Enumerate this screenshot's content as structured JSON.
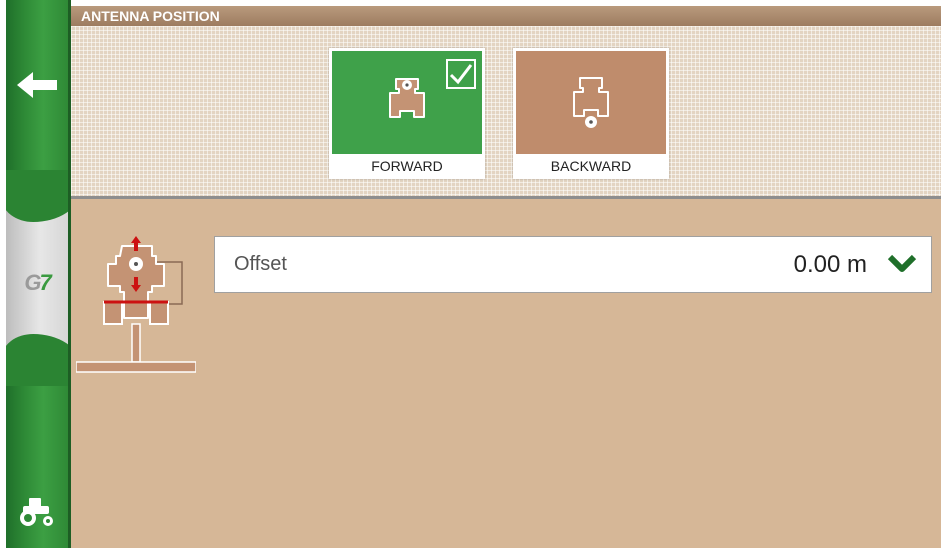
{
  "header": {
    "title": "ANTENNA POSITION"
  },
  "sidebar": {
    "back_icon": "arrow-left-icon",
    "logo_text_g": "G",
    "logo_text_7": "7",
    "tractor_icon": "tractor-icon"
  },
  "options": [
    {
      "label": "FORWARD",
      "selected": true,
      "color": "#3fa14a"
    },
    {
      "label": "BACKWARD",
      "selected": false,
      "color": "#bf8c6c"
    }
  ],
  "offset": {
    "label": "Offset",
    "value": "0.00 m"
  },
  "colors": {
    "accent_green": "#3fa14a",
    "brown": "#bf8c6c",
    "background": "#d6b797",
    "header": "#a88a6e"
  }
}
